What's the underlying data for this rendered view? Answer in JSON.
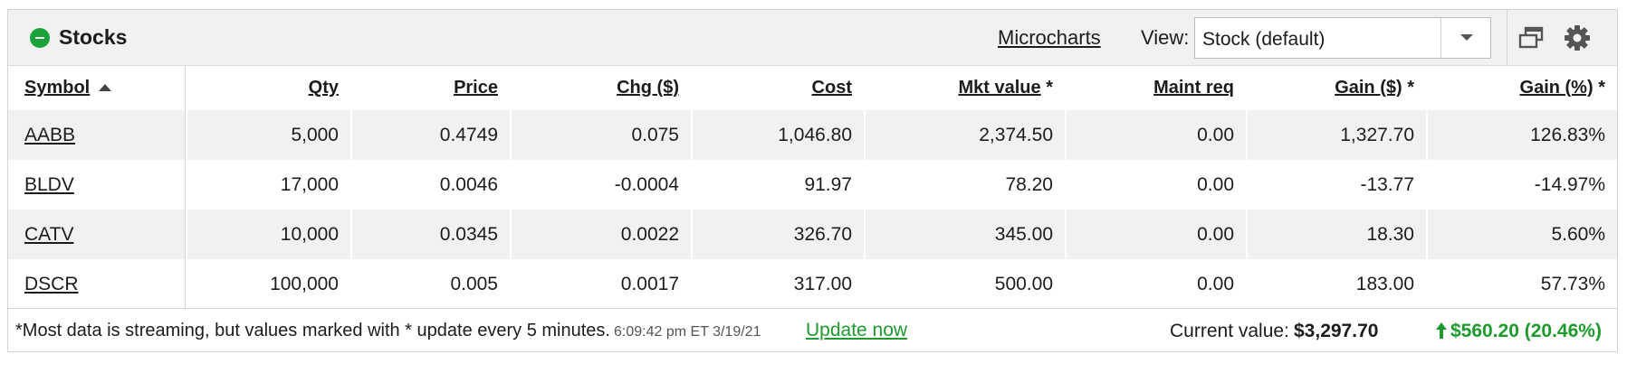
{
  "header": {
    "title": "Stocks",
    "microcharts_label": "Microcharts",
    "view_label": "View:",
    "view_value": "Stock (default)"
  },
  "columns": [
    {
      "label": "Symbol",
      "asterisk": ""
    },
    {
      "label": "Qty",
      "asterisk": ""
    },
    {
      "label": "Price",
      "asterisk": ""
    },
    {
      "label": "Chg ($)",
      "asterisk": ""
    },
    {
      "label": "Cost",
      "asterisk": ""
    },
    {
      "label": "Mkt value",
      "asterisk": "*"
    },
    {
      "label": "Maint req",
      "asterisk": ""
    },
    {
      "label": "Gain ($)",
      "asterisk": "*"
    },
    {
      "label": "Gain (%)",
      "asterisk": "*"
    }
  ],
  "rows": [
    {
      "symbol": "AABB",
      "qty": "5,000",
      "price": "0.4749",
      "chg": "0.075",
      "cost": "1,046.80",
      "mkt_value": "2,374.50",
      "maint_req": "0.00",
      "gain_usd": "1,327.70",
      "gain_pct": "126.83%"
    },
    {
      "symbol": "BLDV",
      "qty": "17,000",
      "price": "0.0046",
      "chg": "-0.0004",
      "cost": "91.97",
      "mkt_value": "78.20",
      "maint_req": "0.00",
      "gain_usd": "-13.77",
      "gain_pct": "-14.97%"
    },
    {
      "symbol": "CATV",
      "qty": "10,000",
      "price": "0.0345",
      "chg": "0.0022",
      "cost": "326.70",
      "mkt_value": "345.00",
      "maint_req": "0.00",
      "gain_usd": "18.30",
      "gain_pct": "5.60%"
    },
    {
      "symbol": "DSCR",
      "qty": "100,000",
      "price": "0.005",
      "chg": "0.0017",
      "cost": "317.00",
      "mkt_value": "500.00",
      "maint_req": "0.00",
      "gain_usd": "183.00",
      "gain_pct": "57.73%"
    }
  ],
  "footer": {
    "note": "*Most data is streaming, but values marked with * update every 5 minutes.",
    "timestamp": "6:09:42 pm ET 3/19/21",
    "update_label": "Update now",
    "current_value_label": "Current value:",
    "current_value": "$3,297.70",
    "total_gain": "$560.20 (20.46%)"
  },
  "colors": {
    "positive": "#1f9a2e",
    "negative": "#d8281f",
    "status_green": "#1aa33b",
    "header_bg": "#f1f1f1"
  },
  "icons": {
    "collapse": "minus-circle-icon",
    "sort": "sort-asc-icon",
    "dropdown": "chevron-down-icon",
    "popout": "popout-window-icon",
    "settings": "gear-icon",
    "trend": "up-arrow-icon"
  }
}
